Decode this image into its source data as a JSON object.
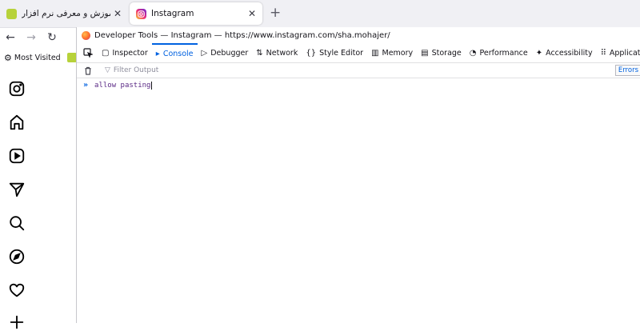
{
  "browser": {
    "tabs": [
      {
        "title": "انزل وب - آموزش و معرفی نرم افزار",
        "favicon": "green-site-favicon",
        "active": false
      },
      {
        "title": "Instagram",
        "favicon": "instagram-favicon",
        "active": true
      }
    ],
    "new_tab_icon": "+",
    "nav": {
      "back_icon": "←",
      "forward_icon": "→",
      "reload_icon": "↻"
    },
    "bookmarks": {
      "most_visited_label": "Most Visited",
      "gear_icon": "⚙"
    }
  },
  "instagram_sidebar": {
    "icons": [
      "instagram-logo-icon",
      "home-icon",
      "reels-icon",
      "messages-icon",
      "search-icon",
      "explore-icon",
      "notifications-icon",
      "create-icon"
    ]
  },
  "devtools": {
    "title": "Developer Tools — Instagram — https://www.instagram.com/sha.mohajer/",
    "tabs": [
      {
        "label": "Inspector",
        "icon": "▢"
      },
      {
        "label": "Console",
        "icon": "▸",
        "active": true
      },
      {
        "label": "Debugger",
        "icon": "▷"
      },
      {
        "label": "Network",
        "icon": "⇅"
      },
      {
        "label": "Style Editor",
        "icon": "{}"
      },
      {
        "label": "Memory",
        "icon": "▥"
      },
      {
        "label": "Storage",
        "icon": "▤"
      },
      {
        "label": "Performance",
        "icon": "◔"
      },
      {
        "label": "Accessibility",
        "icon": "✦"
      },
      {
        "label": "Application",
        "icon": "⠿"
      }
    ],
    "filter_placeholder": "Filter Output",
    "errors_label": "Errors",
    "console_input": "allow pasting",
    "prompt_symbol": "»",
    "accent_color": "#0061e0"
  }
}
